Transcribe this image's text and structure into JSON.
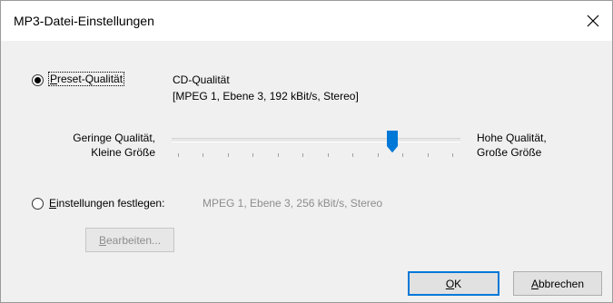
{
  "window": {
    "title": "MP3-Datei-Einstellungen",
    "close_glyph": "close-icon"
  },
  "preset": {
    "label_underlined": "P",
    "label_rest": "reset-Qualität",
    "selected": true,
    "quality_name": "CD-Qualität",
    "quality_detail": "[MPEG 1, Ebene 3, 192 kBit/s, Stereo]"
  },
  "slider": {
    "low_line1": "Geringe Qualität,",
    "low_line2": "Kleine Größe",
    "high_line1": "Hohe Qualität,",
    "high_line2": "Große Größe",
    "value_fraction": 0.78,
    "ticks": 12
  },
  "custom": {
    "label_underlined": "E",
    "label_rest": "instellungen festlegen:",
    "selected": false,
    "value": "MPEG 1, Ebene 3, 256 kBit/s, Stereo"
  },
  "buttons": {
    "edit_underlined": "B",
    "edit_rest": "earbeiten...",
    "ok_underlined": "O",
    "ok_rest": "K",
    "cancel_underlined": "A",
    "cancel_rest": "bbrechen"
  },
  "colors": {
    "thumb": "#0078d7",
    "focus_border": "#0078d7",
    "disabled_text": "#8d8d8d"
  }
}
